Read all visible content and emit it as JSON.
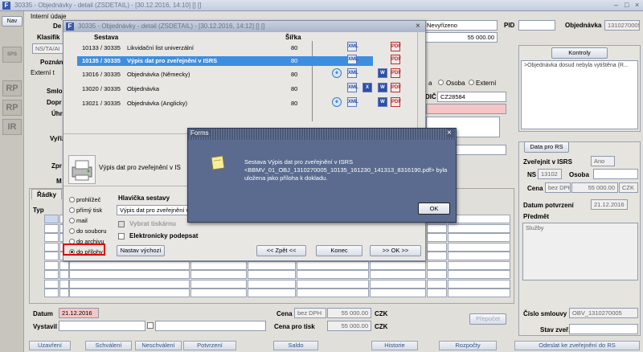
{
  "window": {
    "title": "30335 - Objednávky - detail (ZSDETAIL) - [30.12.2016, 14:10] [] []"
  },
  "left": {
    "nav": "Nav",
    "items": [
      "SPS",
      "RP",
      "RP",
      "IR"
    ]
  },
  "header": {
    "interni_udaje": "Interní údaje",
    "de_label": "De",
    "klasif_label": "Klasifik",
    "klasif_val": "NS/TA/AI",
    "pozn_label": "Poznán",
    "externi": "Externí t",
    "smlo": "Smlo",
    "dopr": "Dopr",
    "uhr": "Úhr",
    "vyriz": "Vyřiz",
    "zpr": "Zpr",
    "m": "M",
    "state": "Nevyřízeno",
    "pid_label": "PID",
    "objednavka_label": "Objednávka",
    "objednavka_val": "1310270005",
    "amount": "55 000.00",
    "radio_osoba": "Osoba",
    "radio_externi": "Externí",
    "radio_a": "a",
    "dic_label": "DIČ",
    "dic_val": "CZ28584",
    "kontroly_label": "Kontroly",
    "kontroly_text": ">Objednávka dosud nebyla vytištěna (R..."
  },
  "rs": {
    "title": "Data pro RS",
    "zverejnit_label": "Zveřejnit v ISRS",
    "zverejnit_val": "Ano",
    "ns_label": "NS",
    "ns_val": "13102",
    "osoba_label": "Osoba",
    "cena_label": "Cena",
    "cena_bez": "bez DPH",
    "cena_val": "55 000.00",
    "cena_cur": "CZK",
    "datum_label": "Datum potvrzení",
    "datum_val": "21.12.2016",
    "predmet_label": "Předmět",
    "predmet_val": "Služby",
    "cislo_label": "Číslo smlouvy",
    "cislo_val": "OBV_1310270005",
    "stav_label": "Stav zveř."
  },
  "dialog": {
    "title": "30335 - Objednávky - detail (ZSDETAIL) - [30.12.2016, 14:12] [] []",
    "col_sestava": "Sestava",
    "col_sirka": "Šířka",
    "rows": [
      {
        "id": "10133 / 30335",
        "name": "Likvidační list univerzální",
        "w": "80"
      },
      {
        "id": "10135 / 30335",
        "name": "Výpis dat pro zveřejnění v ISRS",
        "w": "80"
      },
      {
        "id": "13016 / 30335",
        "name": "Objednávka (Německy)",
        "w": "80"
      },
      {
        "id": "13020 / 30335",
        "name": "Objednávka",
        "w": "80"
      },
      {
        "id": "13021 / 30335",
        "name": "Objednávka (Anglicky)",
        "w": "80"
      }
    ],
    "printer_desc": "Výpis dat pro zveřejnění v IS",
    "radios": [
      "prohlížeč",
      "přímý tisk",
      "mail",
      "do souboru",
      "do archivu",
      "do přílohy"
    ],
    "hlavicka_label": "Hlavička sestavy",
    "hlavicka_val": "Výpis dat pro zveřejnění v I",
    "vybrat": "Vybrat tiskárnu",
    "elektronicky": "Elektronicky podepsat",
    "nastav": "Nastav výchozí",
    "zpet": "<< Zpět <<",
    "konec": "Konec",
    "ok": ">> OK >>",
    "pdf": "PDF (Adobe Acrobat)"
  },
  "forms": {
    "title": "Forms",
    "message": "Sestava Výpis dat pro zveřejnění v ISRS <BBMV_01_OBJ_1310270005_10135_161230_141313_8316190.pdf> byla uložena jako příloha k dokladu.",
    "ok": "OK"
  },
  "radky": {
    "tab": "Řádky",
    "typ": "Typ"
  },
  "bottom": {
    "datum_label": "Datum",
    "datum_val": "21.12.2016",
    "vystavil": "Vystavil",
    "cena_label": "Cena",
    "cena_bez": "bez DPH",
    "cena_val": "55 000.00",
    "czk": "CZK",
    "cena_tisk_label": "Cena pro tisk",
    "cena_tisk_val": "55 000.00",
    "prepocet": "Přepočet"
  },
  "statusbar": [
    "Uzavření",
    "Schválení",
    "Neschválení",
    "Potvrzení",
    "Saldo",
    "Historie",
    "Rozpočty",
    "Odeslat ke zveřejnění do RS"
  ]
}
